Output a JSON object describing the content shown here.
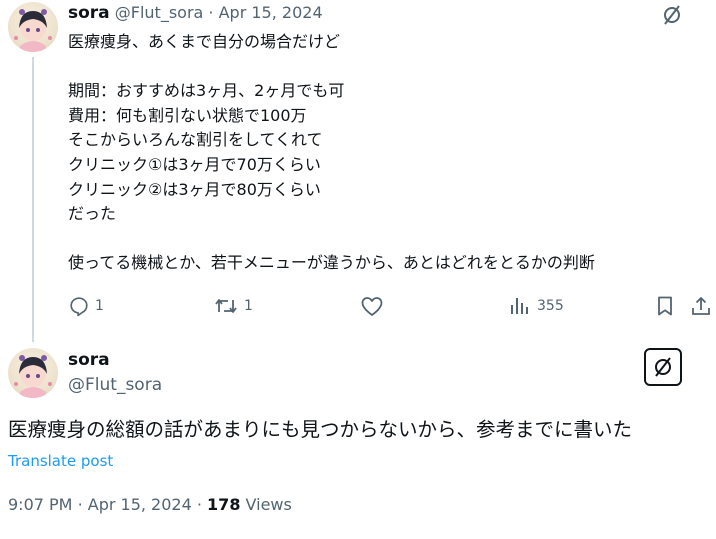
{
  "reply_tweet": {
    "display_name": "sora",
    "handle": "@Flut_sora",
    "separator": "·",
    "date": "Apr 15, 2024",
    "body": "医療痩身、あくまで自分の場合だけど\n\n期間：おすすめは3ヶ月、2ヶ月でも可\n費用：何も割引ない状態で100万\nそこからいろんな割引をしてくれて\nクリニック①は3ヶ月で70万くらい\nクリニック②は3ヶ月で80万くらい\nだった\n\n使ってる機械とか、若干メニューが違うから、あとはどれをとるかの判断",
    "actions": {
      "reply_count": "1",
      "retweet_count": "1",
      "like_count": "",
      "views_count": "355"
    }
  },
  "main_tweet": {
    "display_name": "sora",
    "handle": "@Flut_sora",
    "body": "医療痩身の総額の話があまりにも見つからないから、参考までに書いた",
    "translate_label": "Translate post",
    "time": "9:07 PM",
    "separator": "·",
    "date": "Apr 15, 2024",
    "views_count": "178",
    "views_label": "Views"
  },
  "colors": {
    "text_primary": "#0f1419",
    "text_secondary": "#536471",
    "link": "#1d9bf0",
    "thread_line": "#cfd9de"
  },
  "icons": [
    "grok-icon",
    "reply-icon",
    "retweet-icon",
    "like-icon",
    "views-icon",
    "bookmark-icon",
    "share-icon"
  ]
}
